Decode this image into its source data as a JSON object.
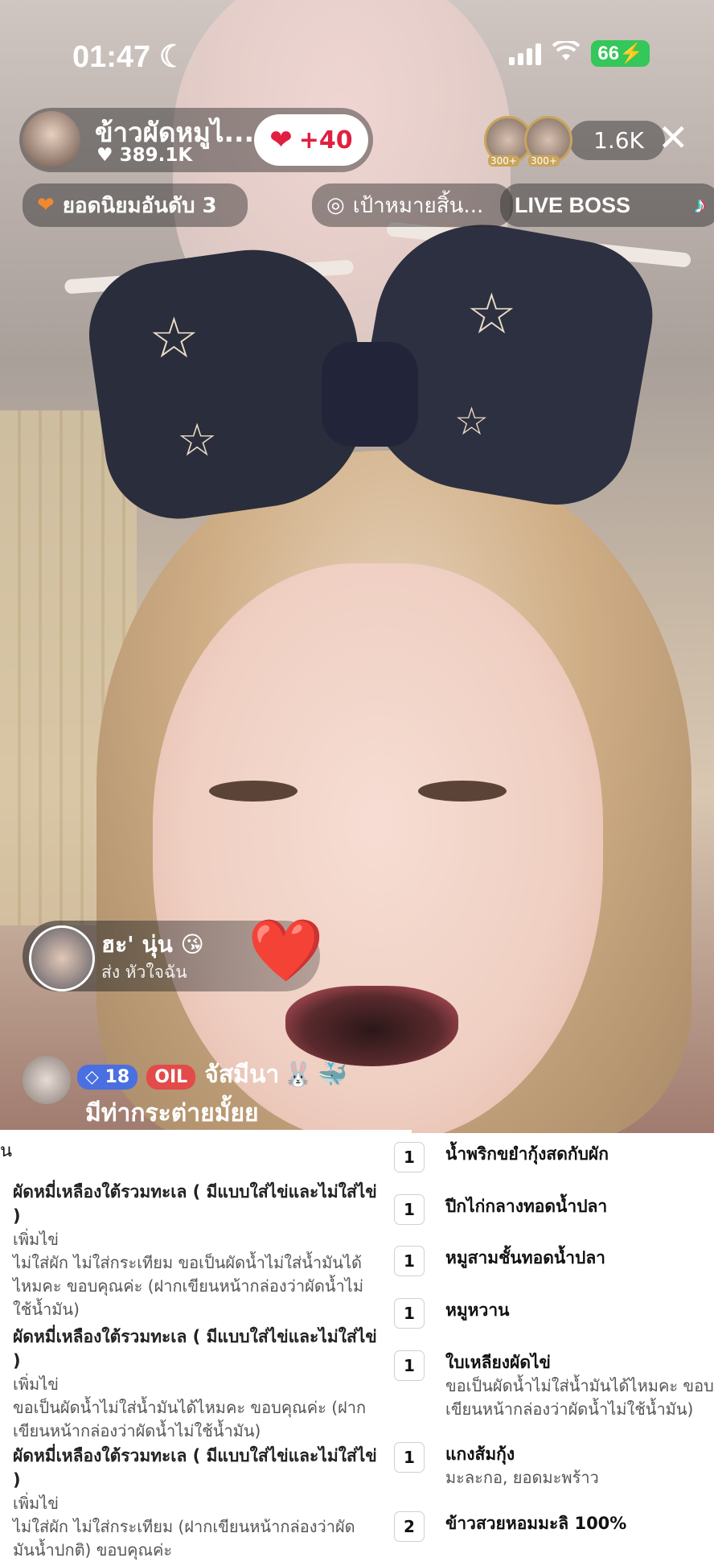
{
  "status_bar": {
    "time": "01:47",
    "moon_icon": "moon-icon",
    "battery": "66"
  },
  "host": {
    "name": "ข้าวผัดหมูไ...",
    "likes": "389.1K"
  },
  "like_button": {
    "label": "+40"
  },
  "viewers": {
    "badge1": "300+",
    "badge2": "300+",
    "count": "1.6K"
  },
  "tags": {
    "rank": "ยอดนิยมอันดับ 3",
    "goal": "เป้าหมายสิ้น...",
    "live_boss": "LIVE BOSS"
  },
  "gift": {
    "user": "ฮะ' นุ่น",
    "subtitle": "ส่ง หัวใจฉัน"
  },
  "comment": {
    "level": "18",
    "team": "OIL",
    "user": "จัสมีนา",
    "text": "มีท่ากระต่ายมั้ยย"
  },
  "order_left": {
    "section": "น",
    "items": [
      {
        "title": "ผัดหมี่เหลืองใต้รวมทะเล ( มีแบบใส่ไข่และไม่ใส่ไข่ )",
        "option": "เพิ่มไข่",
        "note": [
          "ไม่ใส่ผัก ไม่ใส่กระเทียม ขอเป็นผัดน้ำไม่ใส่น้ำมันได้",
          "ไหมคะ ขอบคุณค่ะ (ฝากเขียนหน้ากล่องว่าผัดน้ำไม่",
          "ใช้น้ำมัน)"
        ]
      },
      {
        "title": "ผัดหมี่เหลืองใต้รวมทะเล ( มีแบบใส่ไข่และไม่ใส่ไข่ )",
        "option": "เพิ่มไข่",
        "note": [
          "ขอเป็นผัดน้ำไม่ใส่น้ำมันได้ไหมคะ ขอบคุณค่ะ (ฝาก",
          "เขียนหน้ากล่องว่าผัดน้ำไม่ใช้น้ำมัน)"
        ]
      },
      {
        "title": "ผัดหมี่เหลืองใต้รวมทะเล ( มีแบบใส่ไข่และไม่ใส่ไข่ )",
        "option": "เพิ่มไข่",
        "note": [
          "ไม่ใส่ผัก ไม่ใส่กระเทียม (ฝากเขียนหน้ากล่องว่าผัด",
          "มันน้ำปกติ) ขอบคุณค่ะ"
        ]
      }
    ]
  },
  "order_right": {
    "items": [
      {
        "qty": "1",
        "title": "น้ำพริกขยำกุ้งสดกับผัก",
        "sub": []
      },
      {
        "qty": "1",
        "title": "ปีกไก่กลางทอดน้ำปลา",
        "sub": []
      },
      {
        "qty": "1",
        "title": "หมูสามชั้นทอดน้ำปลา",
        "sub": []
      },
      {
        "qty": "1",
        "title": "หมูหวาน",
        "sub": []
      },
      {
        "qty": "1",
        "title": "ใบเหลียงผัดไข่",
        "sub": [
          "ขอเป็นผัดน้ำไม่ใส่น้ำมันได้ไหมคะ ขอบคุณ",
          "เขียนหน้ากล่องว่าผัดน้ำไม่ใช้น้ำมัน)"
        ]
      },
      {
        "qty": "1",
        "title": "แกงส้มกุ้ง",
        "sub": [
          "มะละกอ, ยอดมะพร้าว"
        ]
      },
      {
        "qty": "2",
        "title": "ข้าวสวยหอมมะลิ 100%",
        "sub": []
      }
    ]
  }
}
